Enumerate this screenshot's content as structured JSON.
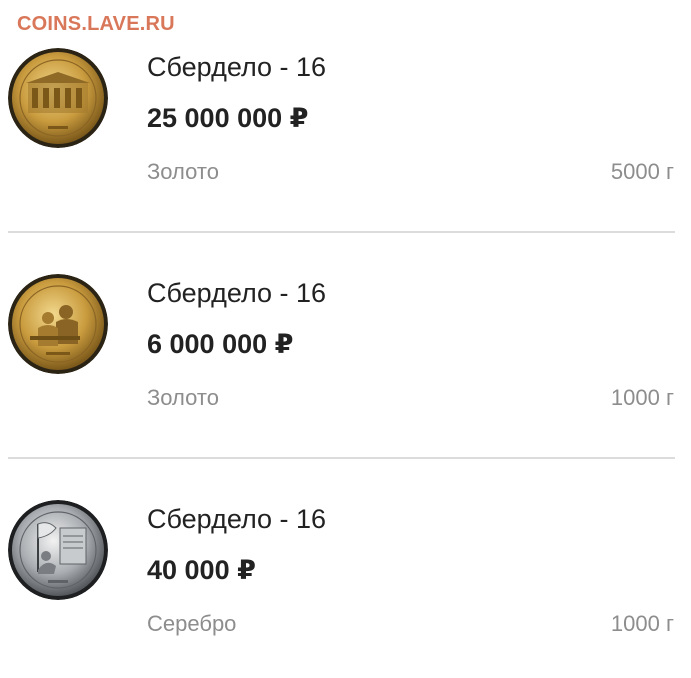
{
  "watermark": "COINS.LAVE.RU",
  "items": [
    {
      "coin_icon": "gold-coin-building-icon",
      "title": "Сбердело - 16",
      "price": "25 000 000 ₽",
      "metal": "Золото",
      "weight": "5000 г"
    },
    {
      "coin_icon": "gold-coin-clerks-icon",
      "title": "Сбердело - 16",
      "price": "6 000 000 ₽",
      "metal": "Золото",
      "weight": "1000 г"
    },
    {
      "coin_icon": "silver-coin-flag-icon",
      "title": "Сбердело - 16",
      "price": "40 000 ₽",
      "metal": "Серебро",
      "weight": "1000 г"
    }
  ],
  "colors": {
    "watermark": "#d9775a",
    "gold": "#c9a24a",
    "silver": "#9aa0a6",
    "muted_text": "#8d8d8d",
    "divider": "#dcdcdc"
  }
}
